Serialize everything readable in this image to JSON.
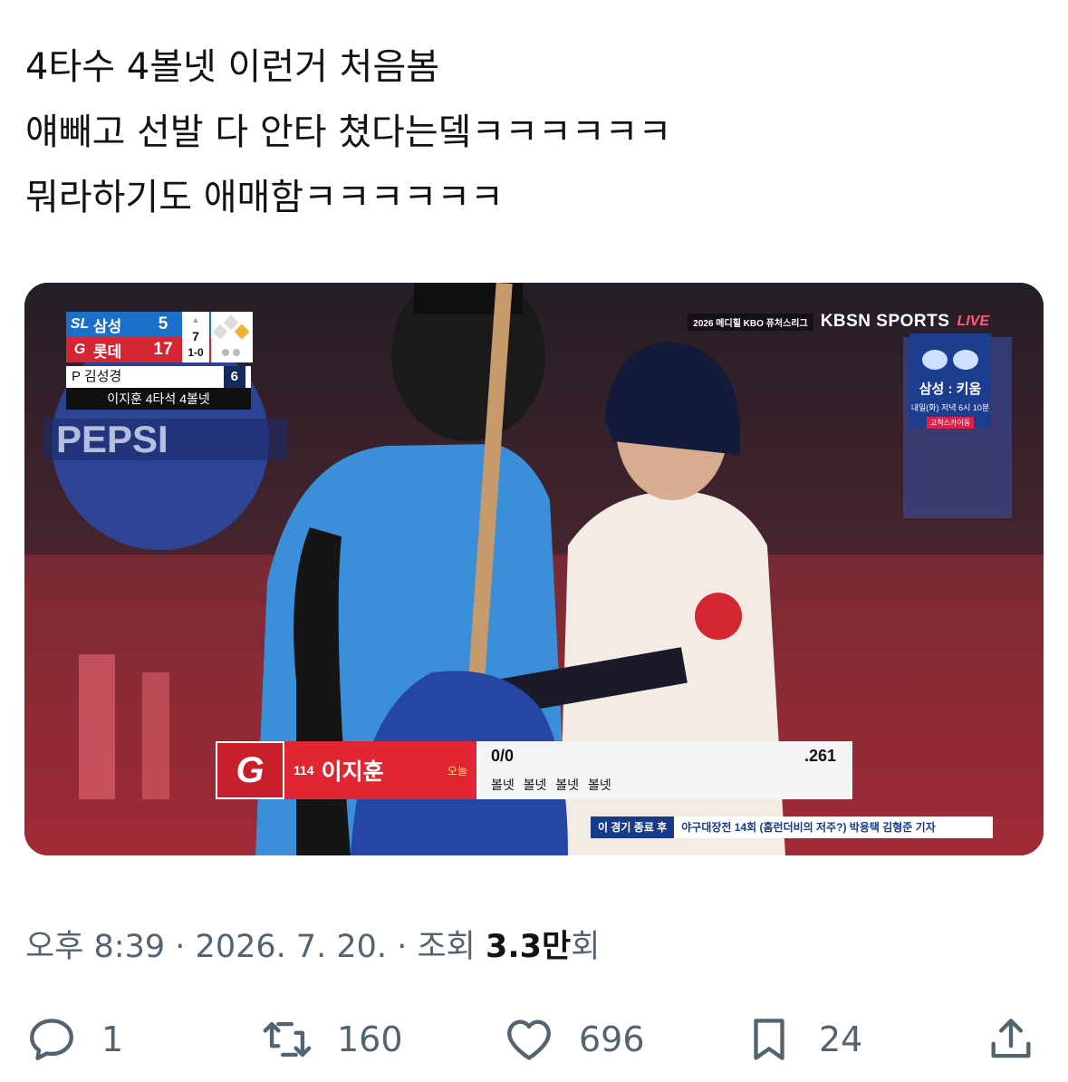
{
  "tweet": {
    "lines": [
      "4타수 4볼넷 이런거 처음봄",
      "얘빼고 선발 다 안타 쳤다는뎈ㅋㅋㅋㅋㅋㅋ",
      "뭐라하기도 애매함ㅋㅋㅋㅋㅋㅋ"
    ]
  },
  "broadcast": {
    "scoreboard": {
      "team1": {
        "logo": "SL",
        "name": "삼성",
        "score": "5"
      },
      "team2": {
        "logo": "G",
        "name": "롯데",
        "score": "17"
      },
      "inning": "7",
      "count": "1-0",
      "pitcher": "P 김성경",
      "pitch_count": "6",
      "note": "이지훈 4타석 4볼넷"
    },
    "network": {
      "league": "2026 메디힐 KBO 퓨처스리그",
      "name": "KBSN SPORTS",
      "live": "LIVE"
    },
    "promo": {
      "teams": "삼성 : 키움",
      "time": "내일(화) 저녁 6시 10분",
      "tag": "고척스카이돔"
    },
    "player": {
      "logo": "G",
      "number": "114",
      "name": "이지훈",
      "today": "오늘",
      "at_bats": "0/0",
      "avg": ".261",
      "results": "볼넷 볼넷 볼넷 볼넷"
    },
    "ticker": {
      "label": "이 경기 종료 후",
      "text": "야구대장전 14회 (홈런더비의 저주?) 박용택 김형준 기자"
    }
  },
  "meta": {
    "time": "오후 8:39",
    "sep1": "·",
    "date": "2026. 7. 20.",
    "sep2": "·",
    "views_label": "조회",
    "views_num": "3.3",
    "views_unit": "만",
    "views_suffix": "회"
  },
  "actions": {
    "reply": {
      "icon": "reply-icon",
      "count": "1"
    },
    "retweet": {
      "icon": "retweet-icon",
      "count": "160"
    },
    "like": {
      "icon": "heart-icon",
      "count": "696"
    },
    "bookmark": {
      "icon": "bookmark-icon",
      "count": "24"
    },
    "share": {
      "icon": "share-icon"
    }
  }
}
